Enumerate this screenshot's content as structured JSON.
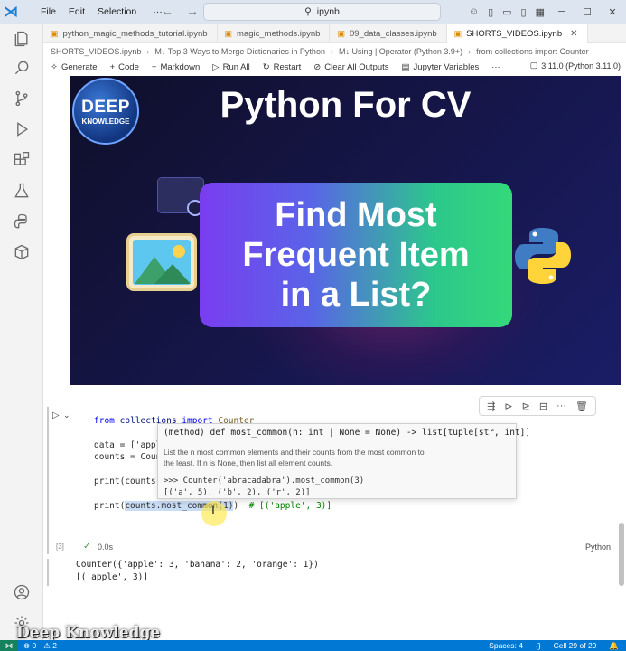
{
  "titlebar": {
    "menu": [
      "File",
      "Edit",
      "Selection"
    ],
    "more": "···",
    "search_text": "ipynb"
  },
  "tabs": [
    {
      "label": "python_magic_methods_tutorial.ipynb",
      "active": false
    },
    {
      "label": "magic_methods.ipynb",
      "active": false
    },
    {
      "label": "09_data_classes.ipynb",
      "active": false
    },
    {
      "label": "SHORTS_VIDEOS.ipynb",
      "active": true
    }
  ],
  "breadcrumbs": [
    "SHORTS_VIDEOS.ipynb",
    "M↓ Top 3 Ways to Merge Dictionaries in Python",
    "M↓ Using | Operator (Python 3.9+)",
    "from collections import Counter"
  ],
  "toolbar": {
    "generate": "Generate",
    "code": "Code",
    "markdown": "Markdown",
    "run_all": "Run All",
    "restart": "Restart",
    "clear_outputs": "Clear All Outputs",
    "variables": "Jupyter Variables",
    "more": "···",
    "kernel": "3.11.0 (Python 3.11.0)"
  },
  "thumbnail": {
    "logo_line1": "DEEP",
    "logo_line2": "KNOWLEDGE",
    "title": "Python For CV",
    "headline_l1": "Find Most",
    "headline_l2": "Frequent Item",
    "headline_l3": "in a List?"
  },
  "cell": {
    "line1_a": "from",
    "line1_b": "collections",
    "line1_c": "import",
    "line1_d": "Counter",
    "line2": "data = ['appl",
    "line3": "counts = Coun",
    "line4": "print(counts)",
    "line5_a": "print(",
    "line5_b": "counts.most_common(1)",
    "line5_c": ")  ",
    "line5_comment": "# [('apple', 3)]",
    "exec_index": "[3]",
    "exec_time": "0.0s",
    "language": "Python"
  },
  "popup": {
    "signature": "(method) def most_common(n: int | None = None) -> list[tuple[str, int]]",
    "doc": "List the n most common elements and their counts from the most common to the least. If n is None, then list all element counts.",
    "example_l1": ">>> Counter('abracadabra').most_common(3)",
    "example_l2": "[('a', 5), ('b', 2), ('r', 2)]"
  },
  "output": {
    "line1": "Counter({'apple': 3, 'banana': 2, 'orange': 1})",
    "line2": "[('apple', 3)]"
  },
  "watermark": "Deep Knowledge",
  "statusbar": {
    "errors": "⊗ 0",
    "warnings": "⚠ 2",
    "spaces": "Spaces: 4",
    "cell": "Cell 29 of 29"
  }
}
